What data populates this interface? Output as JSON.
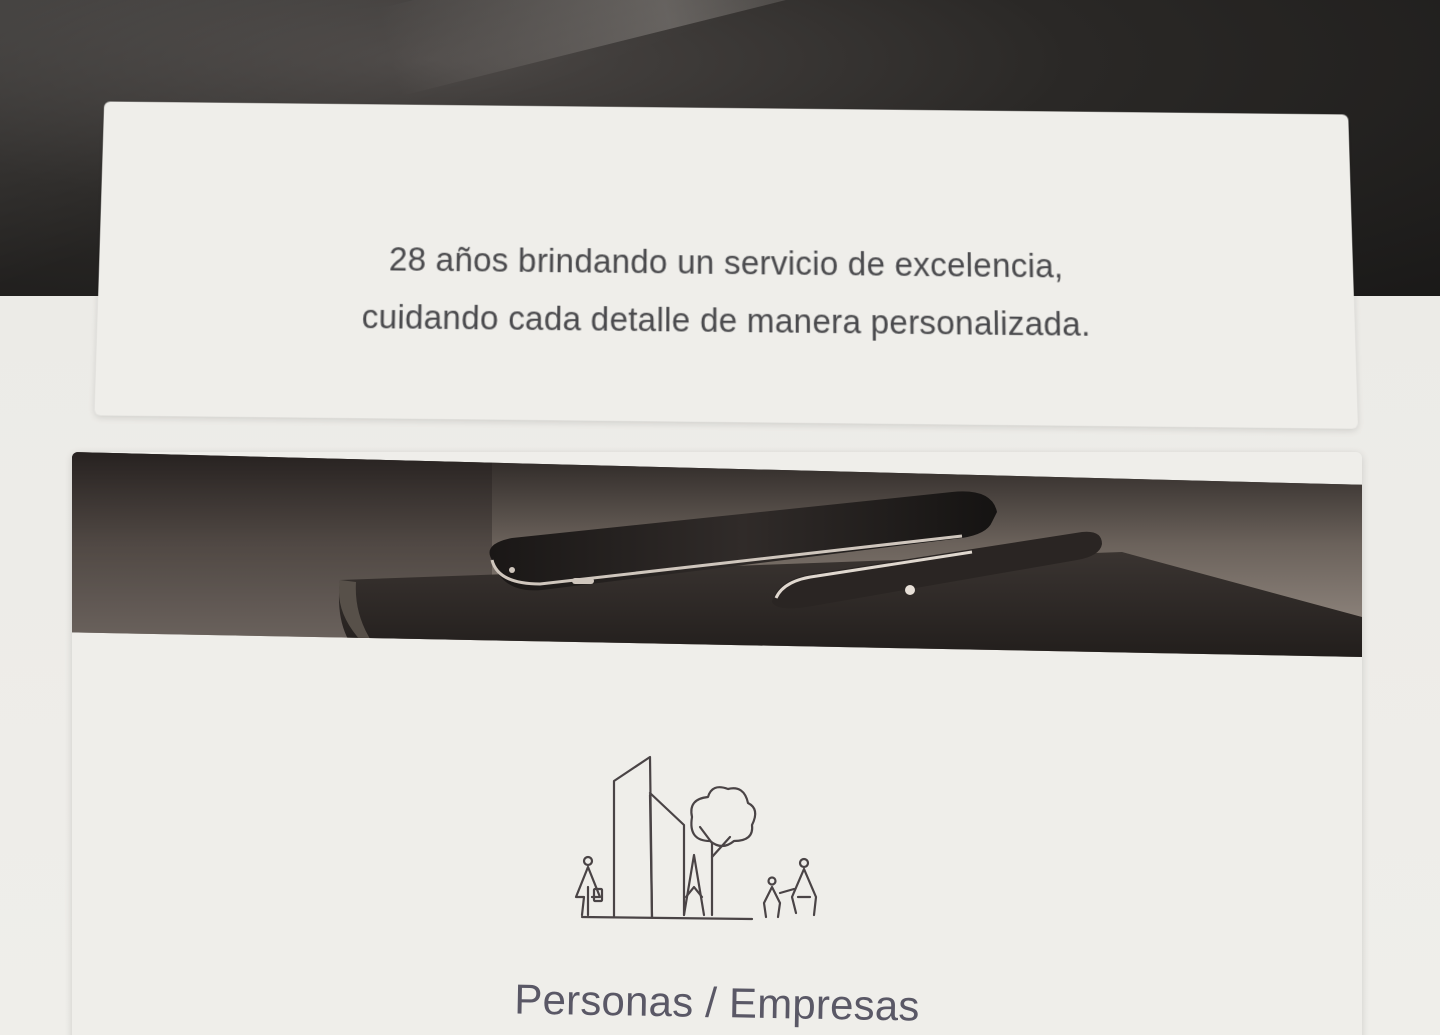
{
  "tagline": {
    "line1": "28 años brindando un servicio de excelencia,",
    "line2": "cuidando cada detalle de manera personalizada."
  },
  "service": {
    "title": "Personas / Empresas",
    "icon": "city-people-icon"
  },
  "banner": {
    "image": "phone-pen-notebook-photo"
  },
  "colors": {
    "text": "#4a4a4d",
    "title": "#5a5866",
    "card": "#efeeea",
    "line_art": "#4a4446"
  }
}
